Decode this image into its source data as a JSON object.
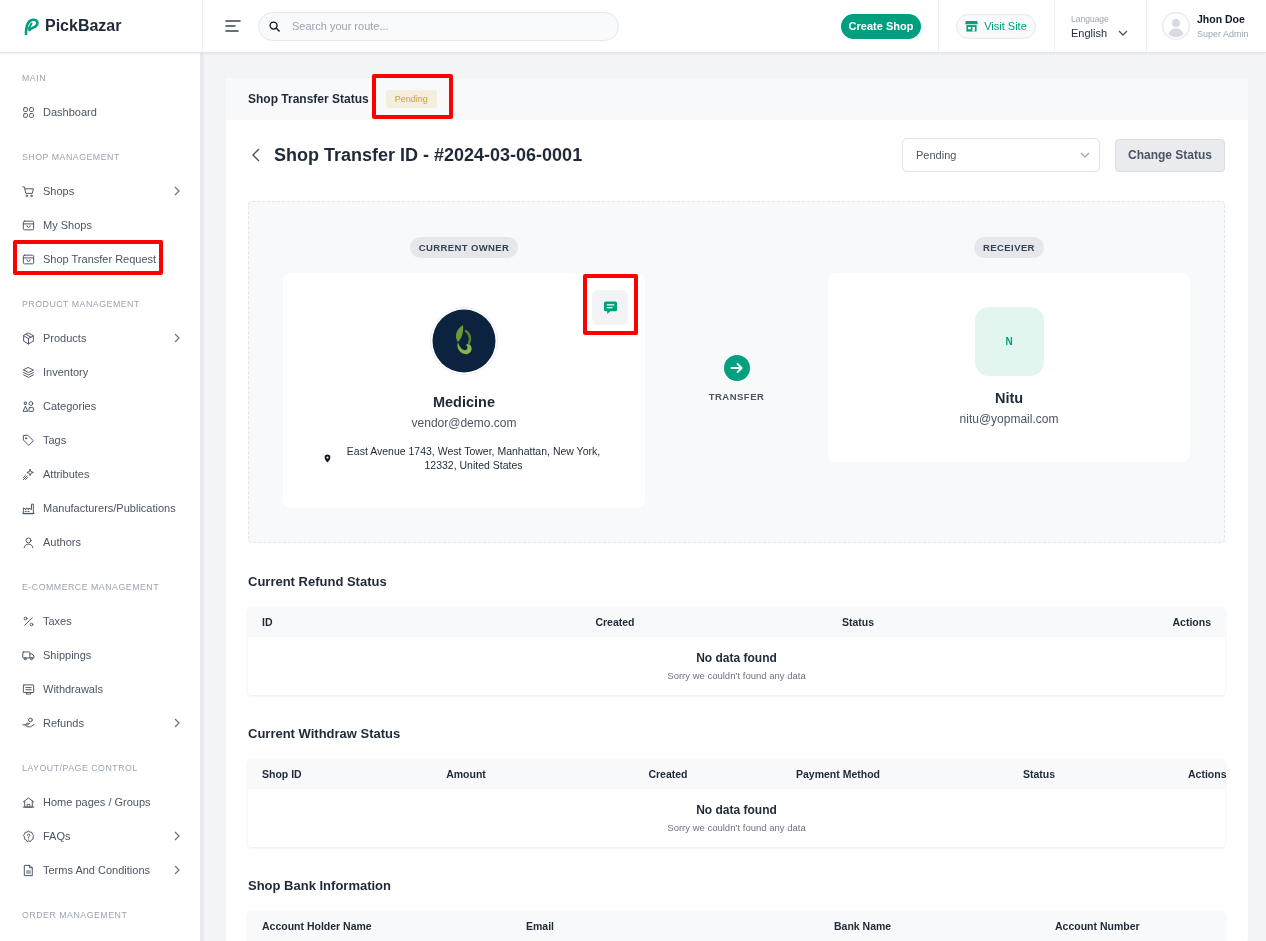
{
  "brand": {
    "name": "PickBazar"
  },
  "header": {
    "search": {
      "placeholder": "Search your route..."
    },
    "create_button": "Create Shop",
    "visit_button": "Visit Site",
    "language": {
      "label": "Language",
      "value": "English"
    },
    "user": {
      "name": "Jhon Doe",
      "role": "Super Admin"
    }
  },
  "sidebar": {
    "sections": [
      {
        "title": "MAIN",
        "items": [
          {
            "label": "Dashboard",
            "expandable": false,
            "highlighted": false
          }
        ]
      },
      {
        "title": "SHOP MANAGEMENT",
        "items": [
          {
            "label": "Shops",
            "expandable": true,
            "highlighted": false
          },
          {
            "label": "My Shops",
            "expandable": false,
            "highlighted": false
          },
          {
            "label": "Shop Transfer Request",
            "expandable": false,
            "highlighted": true
          }
        ]
      },
      {
        "title": "PRODUCT MANAGEMENT",
        "items": [
          {
            "label": "Products",
            "expandable": true,
            "highlighted": false
          },
          {
            "label": "Inventory",
            "expandable": false,
            "highlighted": false
          },
          {
            "label": "Categories",
            "expandable": false,
            "highlighted": false
          },
          {
            "label": "Tags",
            "expandable": false,
            "highlighted": false
          },
          {
            "label": "Attributes",
            "expandable": false,
            "highlighted": false
          },
          {
            "label": "Manufacturers/Publications",
            "expandable": false,
            "highlighted": false
          },
          {
            "label": "Authors",
            "expandable": false,
            "highlighted": false
          }
        ]
      },
      {
        "title": "E-COMMERCE MANAGEMENT",
        "items": [
          {
            "label": "Taxes",
            "expandable": false,
            "highlighted": false
          },
          {
            "label": "Shippings",
            "expandable": false,
            "highlighted": false
          },
          {
            "label": "Withdrawals",
            "expandable": false,
            "highlighted": false
          },
          {
            "label": "Refunds",
            "expandable": true,
            "highlighted": false
          }
        ]
      },
      {
        "title": "LAYOUT/PAGE CONTROL",
        "items": [
          {
            "label": "Home pages / Groups",
            "expandable": false,
            "highlighted": false
          },
          {
            "label": "FAQs",
            "expandable": true,
            "highlighted": false
          },
          {
            "label": "Terms And Conditions",
            "expandable": true,
            "highlighted": false
          }
        ]
      },
      {
        "title": "ORDER MANAGEMENT"
      }
    ]
  },
  "status_card": {
    "title": "Shop Transfer Status",
    "badge": {
      "text": "Pending",
      "highlighted": true
    }
  },
  "transfer": {
    "title": "Shop Transfer ID - #2024-03-06-0001",
    "status_select": {
      "value": "Pending"
    },
    "change_button": "Change Status",
    "owner": {
      "tag": "CURRENT OWNER",
      "name": "Medicine",
      "email": "vendor@demo.com",
      "address": "East Avenue 1743, West Tower, Manhattan, New York, 12332, United States",
      "chat_button": {
        "highlighted": true
      }
    },
    "transfer_label": "TRANSFER",
    "receiver": {
      "tag": "RECEIVER",
      "initial": "N",
      "name": "Nitu",
      "email": "nitu@yopmail.com"
    }
  },
  "tables": [
    {
      "title": "Current Refund Status",
      "columns": [
        "ID",
        "Created",
        "Status",
        "Actions"
      ],
      "empty": {
        "title": "No data found",
        "message": "Sorry we couldn’t found any data"
      }
    },
    {
      "title": "Current Withdraw Status",
      "columns": [
        "Shop ID",
        "Amount",
        "Created",
        "Payment Method",
        "Status",
        "Actions"
      ],
      "empty": {
        "title": "No data found",
        "message": "Sorry we couldn’t found any data"
      }
    },
    {
      "title": "Shop Bank Information",
      "columns": [
        "Account Holder Name",
        "Email",
        "Bank Name",
        "Account Number"
      ]
    }
  ]
}
